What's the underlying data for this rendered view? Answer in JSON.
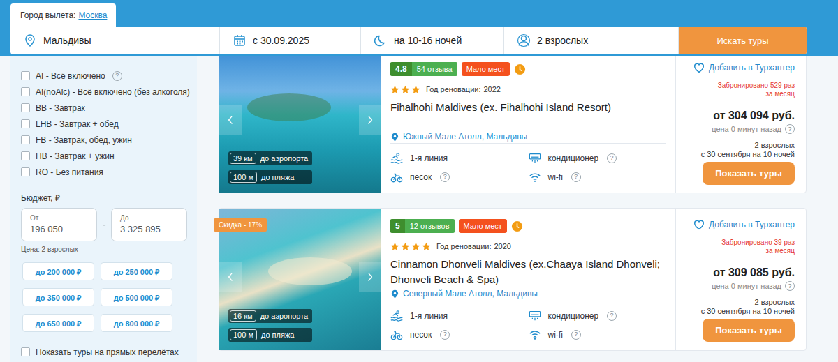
{
  "search": {
    "city_label": "Город вылета:",
    "city": "Москва",
    "fields": [
      {
        "kind": "destination",
        "value": "Мальдивы"
      },
      {
        "kind": "dates",
        "value": "с 30.09.2025"
      },
      {
        "kind": "nights",
        "value": "на 10-16 ночей"
      },
      {
        "kind": "travelers",
        "value": "2 взрослых"
      }
    ],
    "button": "Искать туры"
  },
  "help_glyph": "?",
  "sidebar": {
    "meal_options": [
      {
        "label": "AI - Всё включено",
        "checked": false,
        "help": true
      },
      {
        "label": "AI(noAlc) - Всё включено (без алкоголя)",
        "checked": false,
        "help": false
      },
      {
        "label": "BB - Завтрак",
        "checked": false,
        "help": false
      },
      {
        "label": "LHB - Завтрак + обед",
        "checked": false,
        "help": false
      },
      {
        "label": "FB - Завтрак, обед, ужин",
        "checked": false,
        "help": false
      },
      {
        "label": "HB - Завтрак + ужин",
        "checked": false,
        "help": false
      },
      {
        "label": "RO - Без питания",
        "checked": false,
        "help": false
      }
    ],
    "budget": {
      "title": "Бюджет, ₽",
      "from_label": "От",
      "from": "196 050",
      "dash": "-",
      "to_label": "До",
      "to": "3 325 895",
      "note": "Цена: 2 взрослых",
      "presets": [
        "до 200 000 ₽",
        "до 250 000 ₽",
        "до 350 000 ₽",
        "до 500 000 ₽",
        "до 650 000 ₽",
        "до 800 000 ₽"
      ]
    },
    "direct_flights": {
      "label": "Показать туры на прямых перелётах",
      "checked": false
    }
  },
  "hotels": [
    {
      "discount": "",
      "rating": "4.8",
      "reviews": "54 отзыва",
      "badge": "Мало мест",
      "stars": 3,
      "renovation_label": "Год реновации:",
      "renovation": "2022",
      "title": "Fihalhohi Maldives (ex. Fihalhohi Island Resort)",
      "location": "Южный Мале Атолл, Мальдивы",
      "airport_distance": "39 км",
      "airport_label": "до аэропорта",
      "beach_distance": "100 м",
      "beach_label": "до пляжа",
      "features": [
        {
          "kind": "beach_line",
          "label": "1-я линия",
          "help": false
        },
        {
          "kind": "ac",
          "label": "кондиционер",
          "help": true
        },
        {
          "kind": "sand",
          "label": "песок",
          "help": true
        },
        {
          "kind": "wifi",
          "label": "wi-fi",
          "help": true
        }
      ],
      "favorite": "Добавить в Турхантер",
      "booked": [
        "Забронировано 529 раз",
        "за месяц"
      ],
      "price": "от 304 094 руб.",
      "price_age": "цена 0 минут назад",
      "travelers": "2 взрослых",
      "dates": "с 30 сентября на 10 ночей",
      "button": "Показать туры"
    },
    {
      "discount": "Скидка - 17%",
      "rating": "5",
      "reviews": "12 отзывов",
      "badge": "Мало мест",
      "stars": 4,
      "renovation_label": "Год реновации:",
      "renovation": "2020",
      "title": "Cinnamon Dhonveli Maldives (ex.Chaaya Island Dhonveli; Dhonveli Beach & Spa)",
      "location": "Северный Мале Атолл, Мальдивы",
      "airport_distance": "16 км",
      "airport_label": "до аэропорта",
      "beach_distance": "100 м",
      "beach_label": "до пляжа",
      "features": [
        {
          "kind": "beach_line",
          "label": "1-я линия",
          "help": false
        },
        {
          "kind": "ac",
          "label": "кондиционер",
          "help": true
        },
        {
          "kind": "sand",
          "label": "песок",
          "help": true
        },
        {
          "kind": "wifi",
          "label": "wi-fi",
          "help": true
        }
      ],
      "favorite": "Добавить в Турхантер",
      "booked": [
        "Забронировано 39 раз",
        "за месяц"
      ],
      "price": "от 309 085 руб.",
      "price_age": "цена 0 минут назад",
      "travelers": "2 взрослых",
      "dates": "с 30 сентября на 10 ночей",
      "button": "Показать туры"
    }
  ]
}
